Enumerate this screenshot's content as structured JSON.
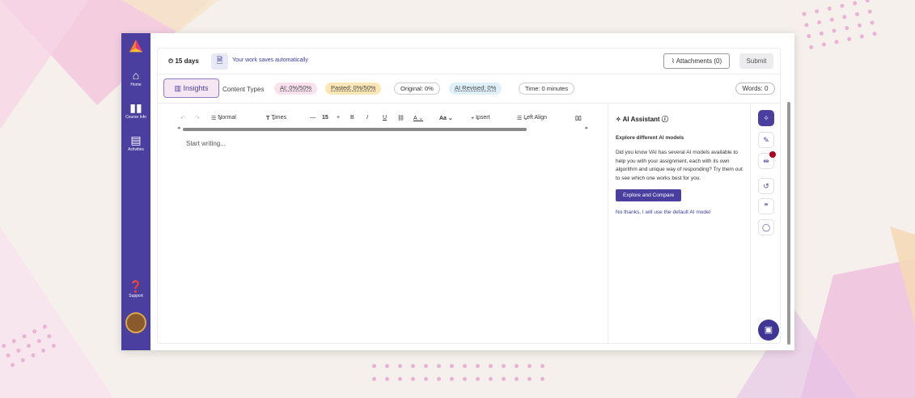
{
  "topbar": {
    "days": "15 days",
    "save_notice": "Your work saves automatically",
    "attachments_label": "Attachments (0)",
    "submit_label": "Submit"
  },
  "sidebar": {
    "items": [
      {
        "label": "Home",
        "icon": "home-icon"
      },
      {
        "label": "Course Info",
        "icon": "book-icon"
      },
      {
        "label": "Activities",
        "icon": "document-icon"
      },
      {
        "label": "Support",
        "icon": "help-icon"
      }
    ]
  },
  "stats": {
    "insights_label": "Insights",
    "content_types_label": "Content Types",
    "ai": "AI: 0%/50%",
    "pasted": "Pasted: 0%/50%",
    "original": "Original: 0%",
    "ai_revised": "AI Revised: 0%",
    "time": "Time: 0 minutes",
    "words": "Words: 0"
  },
  "editor": {
    "style": "Normal",
    "font": "Times",
    "font_size": "15",
    "insert_label": "Insert",
    "align_label": "Left Align",
    "placeholder": "Start writing..."
  },
  "ai_assistant": {
    "title": "AI Assistant",
    "subtitle": "Explore different AI models",
    "body": "Did you know VAI has several AI models available to help you with your assignment, each with its own algorithm and unique way of responding? Try them out to see which one works best for you.",
    "button_label": "Explore and Compare",
    "decline_link": "No thanks, I will use the default AI model"
  },
  "colors": {
    "brand": "#4a3f9e",
    "pasted_bg": "#fbe7b5",
    "ai_bg": "#f9e1ee",
    "revised_bg": "#dff0fa"
  }
}
